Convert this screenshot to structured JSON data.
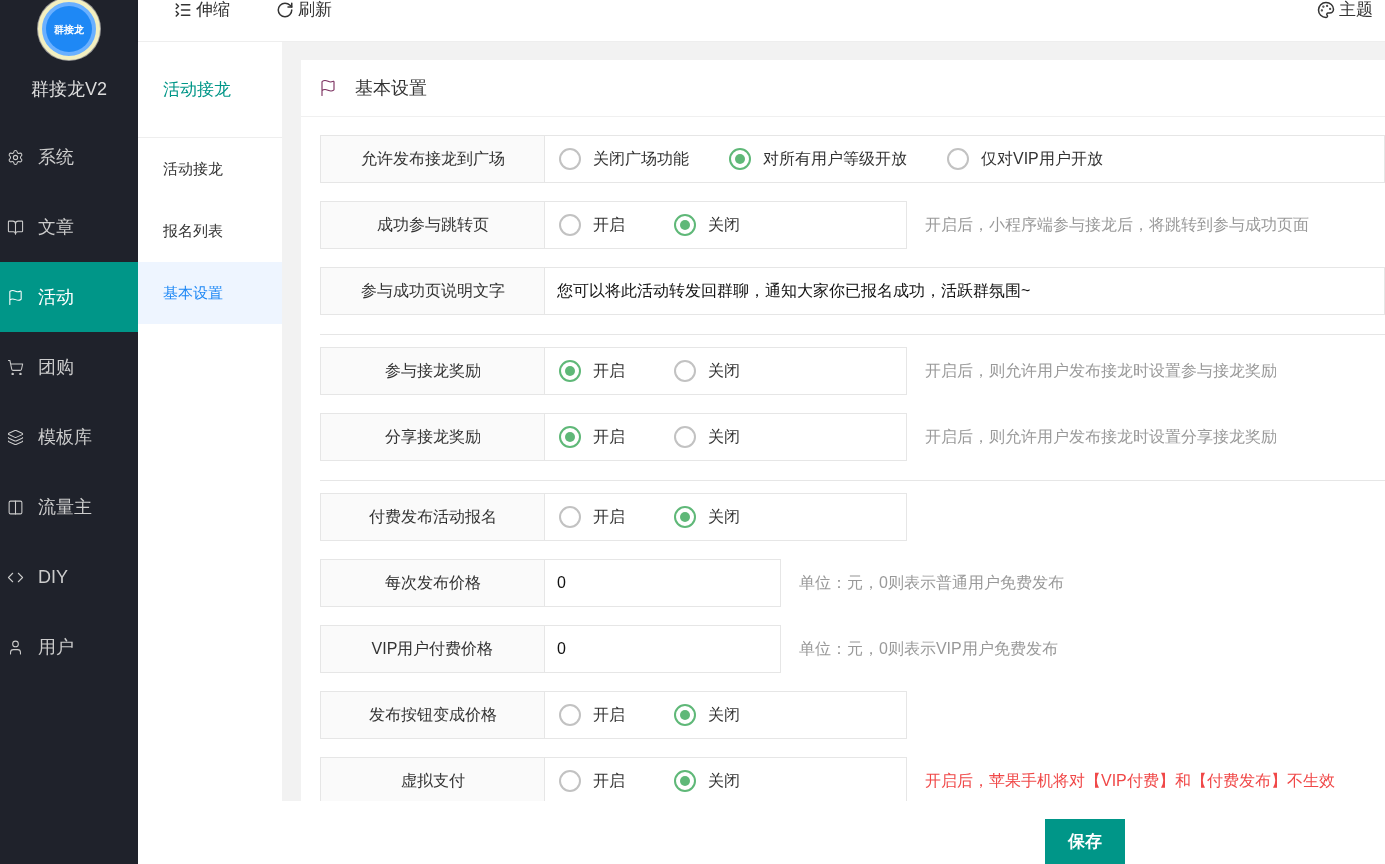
{
  "logo": {
    "badge": "群接龙",
    "title": "群接龙V2"
  },
  "menu": [
    {
      "label": "系统",
      "selected": false
    },
    {
      "label": "文章",
      "selected": false
    },
    {
      "label": "活动",
      "selected": true
    },
    {
      "label": "团购",
      "selected": false
    },
    {
      "label": "模板库",
      "selected": false
    },
    {
      "label": "流量主",
      "selected": false
    },
    {
      "label": "DIY",
      "selected": false
    },
    {
      "label": "用户",
      "selected": false
    }
  ],
  "toolbar": {
    "left": [
      {
        "label": "伸缩"
      },
      {
        "label": "刷新"
      }
    ],
    "right": {
      "label": "主题"
    }
  },
  "submenu": {
    "title": "活动接龙",
    "items": [
      {
        "label": "活动接龙",
        "selected": false
      },
      {
        "label": "报名列表",
        "selected": false
      },
      {
        "label": "基本设置",
        "selected": true
      }
    ]
  },
  "card": {
    "title": "基本设置",
    "groups": [
      [
        {
          "kind": "radio",
          "label": "允许发布接龙到广场",
          "wide": true,
          "options": [
            {
              "label": "关闭广场功能",
              "selected": false
            },
            {
              "label": "对所有用户等级开放",
              "selected": true
            },
            {
              "label": "仅对VIP用户开放",
              "selected": false
            }
          ]
        },
        {
          "kind": "radio",
          "label": "成功参与跳转页",
          "options": [
            {
              "label": "开启",
              "selected": false
            },
            {
              "label": "关闭",
              "selected": true
            }
          ],
          "hint": "开启后，小程序端参与接龙后，将跳转到参与成功页面"
        },
        {
          "kind": "text",
          "label": "参与成功页说明文字",
          "value": "您可以将此活动转发回群聊，通知大家你已报名成功，活跃群氛围~"
        }
      ],
      [
        {
          "kind": "radio",
          "label": "参与接龙奖励",
          "options": [
            {
              "label": "开启",
              "selected": true
            },
            {
              "label": "关闭",
              "selected": false
            }
          ],
          "hint": "开启后，则允许用户发布接龙时设置参与接龙奖励"
        },
        {
          "kind": "radio",
          "label": "分享接龙奖励",
          "options": [
            {
              "label": "开启",
              "selected": true
            },
            {
              "label": "关闭",
              "selected": false
            }
          ],
          "hint": "开启后，则允许用户发布接龙时设置分享接龙奖励"
        }
      ],
      [
        {
          "kind": "radio",
          "label": "付费发布活动报名",
          "options": [
            {
              "label": "开启",
              "selected": false
            },
            {
              "label": "关闭",
              "selected": true
            }
          ]
        },
        {
          "kind": "number",
          "label": "每次发布价格",
          "value": "0",
          "hint": "单位：元，0则表示普通用户免费发布"
        },
        {
          "kind": "number",
          "label": "VIP用户付费价格",
          "value": "0",
          "hint": "单位：元，0则表示VIP用户免费发布"
        },
        {
          "kind": "radio",
          "label": "发布按钮变成价格",
          "options": [
            {
              "label": "开启",
              "selected": false
            },
            {
              "label": "关闭",
              "selected": true
            }
          ]
        },
        {
          "kind": "radio",
          "label": "虚拟支付",
          "options": [
            {
              "label": "开启",
              "selected": false
            },
            {
              "label": "关闭",
              "selected": true
            }
          ],
          "hint": "开启后，苹果手机将对【VIP付费】和【付费发布】不生效",
          "warning": true
        }
      ]
    ]
  },
  "save_button": "保存"
}
